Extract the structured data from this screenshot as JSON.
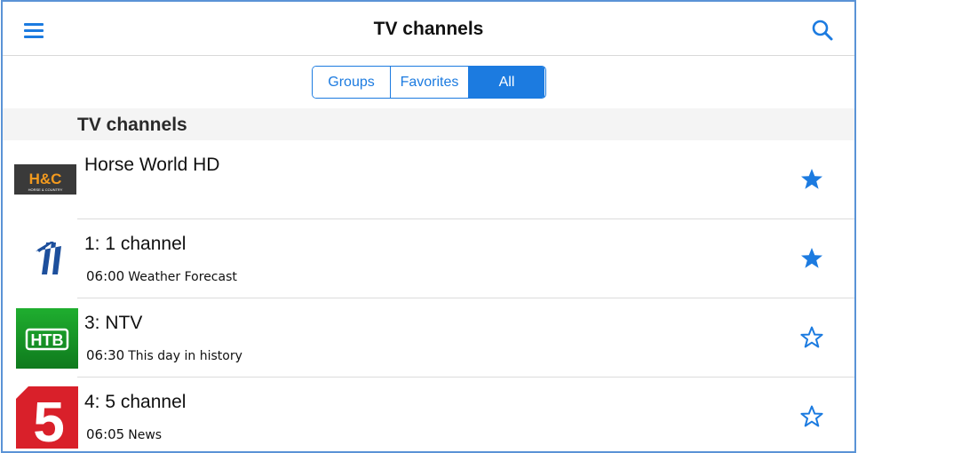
{
  "header": {
    "title": "TV channels",
    "menu_icon": "hamburger-menu-icon",
    "search_icon": "search-icon"
  },
  "segments": [
    {
      "label": "Groups",
      "active": false
    },
    {
      "label": "Favorites",
      "active": false
    },
    {
      "label": "All",
      "active": true
    }
  ],
  "section": {
    "title": "TV channels"
  },
  "channels": [
    {
      "name": "Horse World HD",
      "logo": "horse-country-logo",
      "logo_text": "H&C",
      "logo_subtext": "HORSE & COUNTRY",
      "program_time": "",
      "program_title": "",
      "favorite": true
    },
    {
      "name": "1:  1 channel",
      "logo": "channel-one-logo",
      "program_time": "06:00",
      "program_title": "Weather Forecast",
      "favorite": true
    },
    {
      "name": "3: NTV",
      "logo": "ntv-logo",
      "logo_text": "НТВ",
      "program_time": "06:30",
      "program_title": "This day in history",
      "favorite": false
    },
    {
      "name": "4: 5 channel",
      "logo": "channel-five-logo",
      "logo_text": "5",
      "program_time": "06:05",
      "program_title": "News",
      "favorite": false
    }
  ],
  "colors": {
    "accent": "#1c7be0",
    "section_bg": "#f4f4f4",
    "frame_border": "#5a93d6"
  }
}
